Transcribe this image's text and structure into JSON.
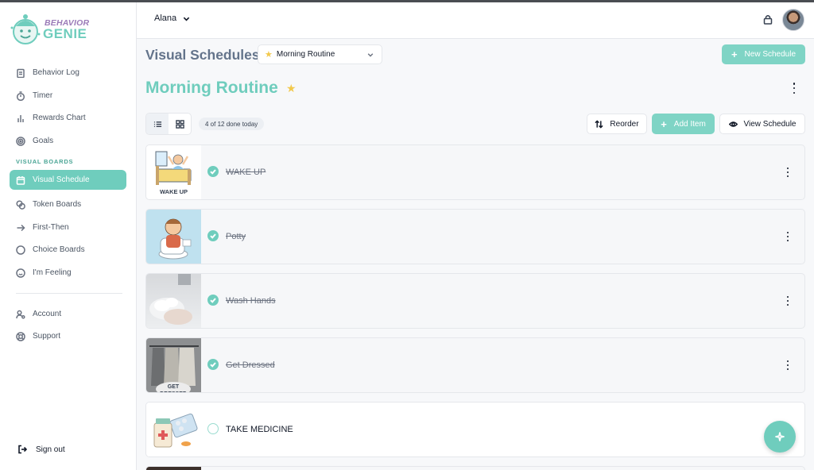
{
  "brand": {
    "name_top": "BEHAVIOR",
    "name_bottom": "GENIE"
  },
  "sidebar": {
    "items": [
      {
        "label": "Behavior Log",
        "icon": "clipboard-icon"
      },
      {
        "label": "Timer",
        "icon": "stopwatch-icon"
      },
      {
        "label": "Rewards Chart",
        "icon": "bar-chart-icon"
      },
      {
        "label": "Goals",
        "icon": "target-icon"
      }
    ],
    "section_label": "VISUAL BOARDS",
    "boards": [
      {
        "label": "Visual Schedule",
        "icon": "calendar-icon",
        "active": true
      },
      {
        "label": "Token Boards",
        "icon": "coins-icon"
      },
      {
        "label": "First-Then",
        "icon": "arrow-right-icon"
      },
      {
        "label": "Choice Boards",
        "icon": "circle-icon"
      },
      {
        "label": "I'm Feeling",
        "icon": "smile-icon"
      }
    ],
    "footer_items": [
      {
        "label": "Account",
        "icon": "user-gear-icon"
      },
      {
        "label": "Support",
        "icon": "lifebuoy-icon"
      }
    ],
    "sign_out": "Sign out"
  },
  "topbar": {
    "user_name": "Alana"
  },
  "header": {
    "page_title": "Visual Schedules",
    "selected_schedule": "Morning Routine",
    "new_schedule": "New Schedule"
  },
  "routine": {
    "title": "Morning Routine",
    "progress": "4 of 12 done today",
    "reorder": "Reorder",
    "add_item": "Add Item",
    "view_schedule": "View Schedule"
  },
  "items": [
    {
      "label": "WAKE UP",
      "done": true,
      "thumb_caption": "WAKE UP"
    },
    {
      "label": "Potty",
      "done": true
    },
    {
      "label": "Wash Hands",
      "done": true
    },
    {
      "label": "Get Dressed",
      "done": true,
      "thumb_caption": "GET DRESSED"
    },
    {
      "label": "TAKE MEDICINE",
      "done": false
    }
  ],
  "colors": {
    "accent": "#6fcdbd",
    "accent_light": "#7fd4c5",
    "star": "#f2c94c",
    "brand_purple": "#9b7bb8"
  }
}
